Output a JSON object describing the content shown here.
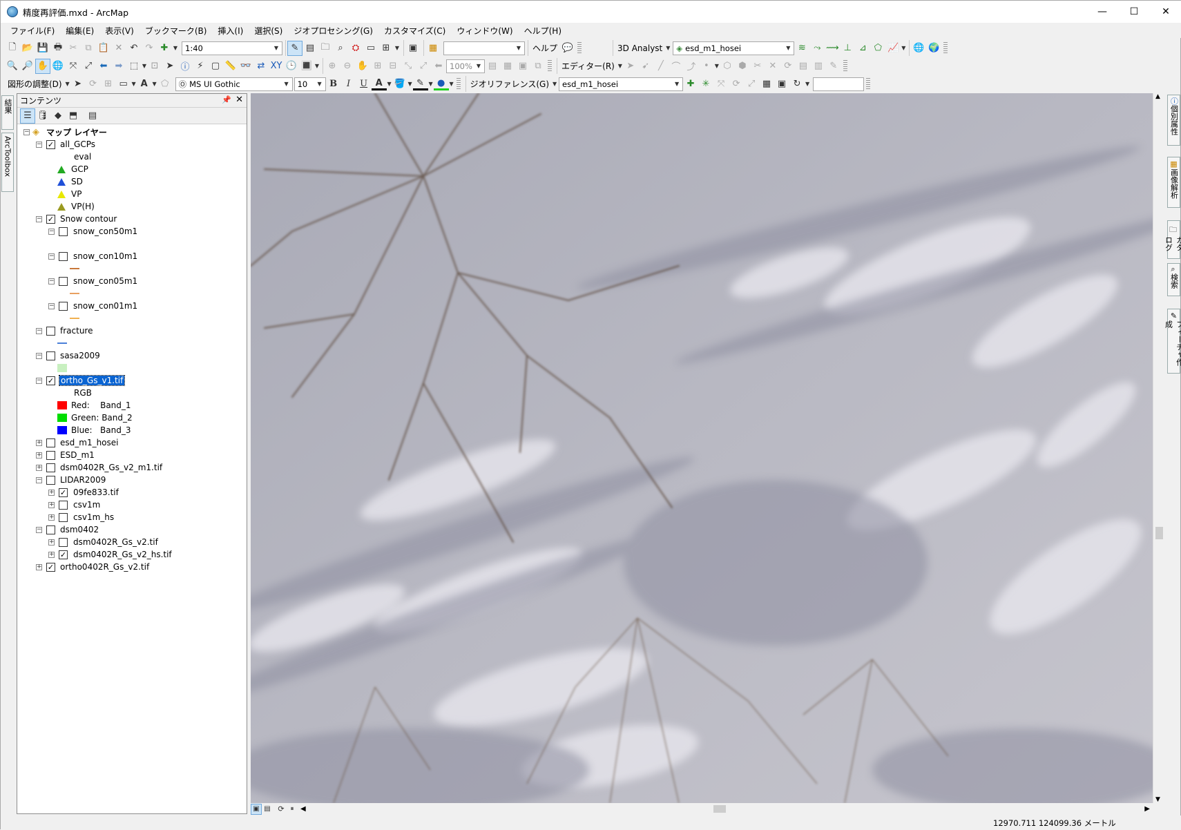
{
  "window": {
    "title": "精度再評価.mxd - ArcMap",
    "minimize": "—",
    "maximize": "☐",
    "close": "✕"
  },
  "menu": [
    "ファイル(F)",
    "編集(E)",
    "表示(V)",
    "ブックマーク(B)",
    "挿入(I)",
    "選択(S)",
    "ジオプロセシング(G)",
    "カスタマイズ(C)",
    "ウィンドウ(W)",
    "ヘルプ(H)"
  ],
  "toolbar1": {
    "scale": "1:40",
    "help_label": "ヘルプ",
    "analyst_label": "3D Analyst",
    "analyst_layer": "esd_m1_hosei"
  },
  "toolbar2": {
    "zoom": "100%",
    "editor_label": "エディター(R)"
  },
  "toolbar3": {
    "drawing_label": "図形の調整(D)",
    "font": "MS UI Gothic",
    "font_size": "10",
    "bold": "B",
    "italic": "I",
    "underline": "U",
    "georef_label": "ジオリファレンス(G)",
    "georef_layer": "esd_m1_hosei"
  },
  "toc": {
    "title": "コンテンツ",
    "root": "マップ レイヤー",
    "layers": {
      "all_gcps": "all_GCPs",
      "eval": "eval",
      "gcp": "GCP",
      "sd": "SD",
      "vp": "VP",
      "vph": "VP(H)",
      "snow_contour": "Snow contour",
      "con50": "snow_con50m1",
      "con10": "snow_con10m1",
      "con05": "snow_con05m1",
      "con01": "snow_con01m1",
      "fracture": "fracture",
      "sasa": "sasa2009",
      "ortho": "ortho_Gs_v1.tif",
      "rgb": "RGB",
      "red": "Red:    Band_1",
      "green": "Green: Band_2",
      "blue": "Blue:   Band_3",
      "esd_hosei": "esd_m1_hosei",
      "esd": "ESD_m1",
      "dsm_v2": "dsm0402R_Gs_v2_m1.tif",
      "lidar": "LIDAR2009",
      "fe833": "09fe833.tif",
      "csv1m": "csv1m",
      "csv1m_hs": "csv1m_hs",
      "dsm0402": "dsm0402",
      "dsm_tif": "dsm0402R_Gs_v2.tif",
      "dsm_hs": "dsm0402R_Gs_v2_hs.tif",
      "ortho0402": "ortho0402R_Gs_v2.tif"
    }
  },
  "left_tabs": {
    "results": "結果",
    "arctoolbox": "ArcToolbox"
  },
  "right_tabs": {
    "identify": "個別属性",
    "image_analysis": "画像解析",
    "catalog": "カタログ",
    "search": "検索",
    "create_features": "フィーチャ作成"
  },
  "status": {
    "coordinates": "12970.711  124099.36 メートル"
  },
  "colors": {
    "selection": "#0a64d2",
    "red_band": "#ff0000",
    "green_band": "#00dd00",
    "blue_band": "#0000ff",
    "gcp": "#22aa22",
    "sd": "#1f4fd8",
    "vp": "#e8e800",
    "vph": "#9a9a20",
    "contour": "#c8783a",
    "fracture": "#4a7fd8",
    "sasa": "#c8f0c0"
  }
}
